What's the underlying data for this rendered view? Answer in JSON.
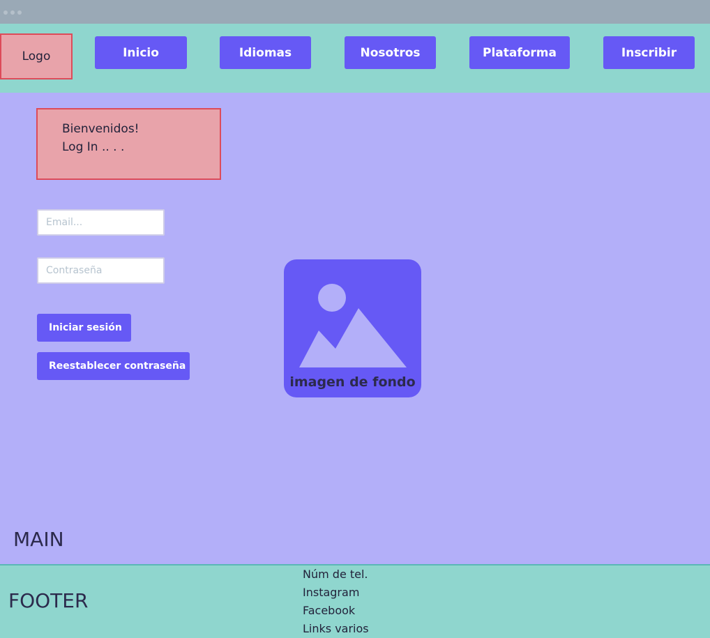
{
  "header": {
    "logo_label": "Logo",
    "nav": [
      "Inicio",
      "Idiomas",
      "Nosotros",
      "Plataforma",
      "Inscribir"
    ]
  },
  "welcome": {
    "line1": "Bienvenidos!",
    "line2": "Log In .. . ."
  },
  "form": {
    "email_placeholder": "Email...",
    "password_placeholder": "Contraseña",
    "login_button": "Iniciar sesión",
    "reset_button": "Reestablecer contraseña"
  },
  "background_image": {
    "caption": "imagen de fondo",
    "icon": "image-placeholder-icon"
  },
  "main": {
    "label": "MAIN"
  },
  "footer": {
    "label": "FOOTER",
    "links": [
      "Núm de tel.",
      "Instagram",
      "Facebook",
      "Links varios"
    ]
  },
  "colors": {
    "main_bg": "#b3aff9",
    "header_bg": "#8fd6ce",
    "accent": "#6659f5",
    "highlight": "#e8a3aa",
    "highlight_border": "#dd4b59"
  }
}
